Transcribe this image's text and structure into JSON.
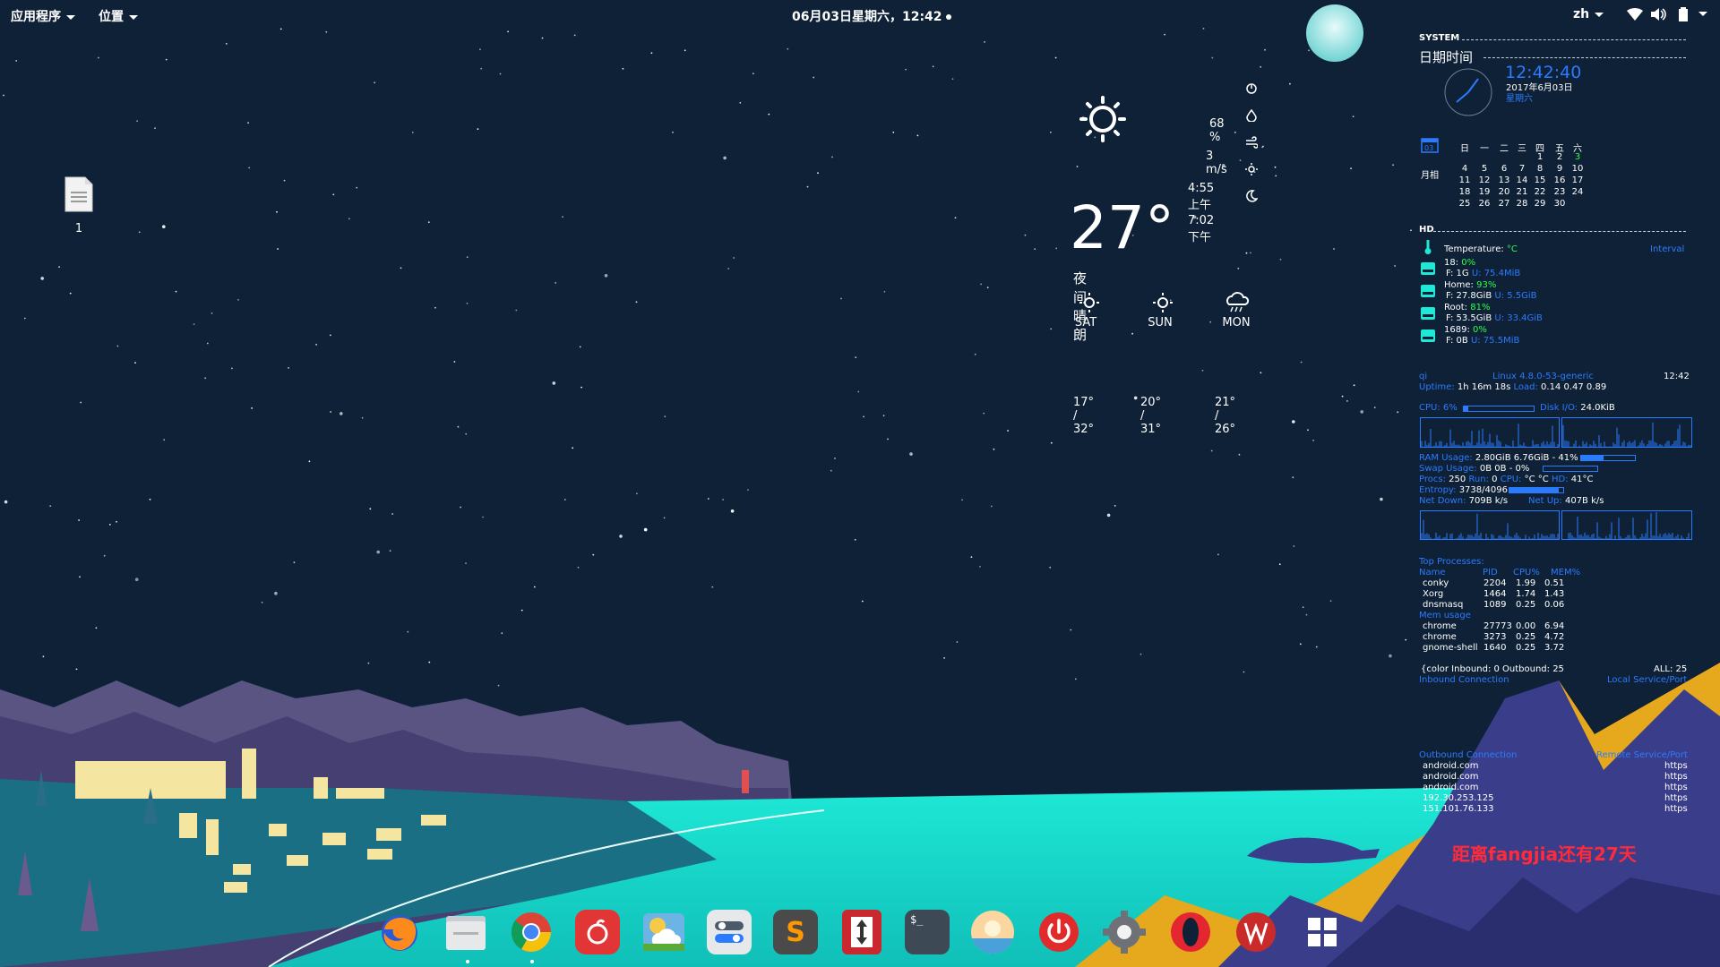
{
  "topbar": {
    "applications_label": "应用程序",
    "places_label": "位置",
    "datetime": "06月03日星期六，12:42",
    "language": "zh",
    "icons": [
      "wifi-icon",
      "volume-icon",
      "battery-icon",
      "power-menu-icon"
    ]
  },
  "desktop": {
    "files": [
      {
        "label": "1",
        "icon": "document-icon"
      }
    ]
  },
  "weather": {
    "current_icon": "sun-icon",
    "temperature": "27°",
    "condition": "夜间晴朗",
    "humidity": "68 %",
    "wind": "3 m/s",
    "sunrise": "4:55 上午",
    "sunset": "7:02 下午",
    "side_icons": [
      "pressure-icon",
      "humidity-icon",
      "wind-icon",
      "sunrise-icon",
      "moon-icon"
    ],
    "forecast": [
      {
        "day": "SAT",
        "icon": "sun-icon",
        "range": "17° / 32°"
      },
      {
        "day": "SUN",
        "icon": "sun-icon",
        "range": "20° / 31°"
      },
      {
        "day": "MON",
        "icon": "rain-cloud-icon",
        "range": "21° / 26°"
      }
    ]
  },
  "conky": {
    "system_header": "SYSTEM",
    "datetime_header": "日期时间",
    "clock_digital": "12:42:40",
    "date_line": "2017年6月03日",
    "weekday_line": "星期六",
    "calendar": {
      "icon_day": "03",
      "month_label": "月相",
      "weekdays": [
        "日",
        "一",
        "二",
        "三",
        "四",
        "五",
        "六"
      ],
      "rows": [
        [
          "",
          "",
          "",
          "",
          "1",
          "2",
          "3"
        ],
        [
          "4",
          "5",
          "6",
          "7",
          "8",
          "9",
          "10"
        ],
        [
          "11",
          "12",
          "13",
          "14",
          "15",
          "16",
          "17"
        ],
        [
          "18",
          "19",
          "20",
          "21",
          "22",
          "23",
          "24"
        ],
        [
          "25",
          "26",
          "27",
          "28",
          "29",
          "30",
          ""
        ]
      ],
      "today": "3"
    },
    "hd_header": "HD",
    "temperature_label": "Temperature:",
    "temperature_unit": "°C",
    "temperature_right": "Interval",
    "disks": [
      {
        "name": "18:",
        "pct": "0%",
        "free": "F: 1G",
        "used": "U: 75.4MiB"
      },
      {
        "name": "Home:",
        "pct": "93%",
        "free": "F: 27.8GiB",
        "used": "U: 5.5GiB"
      },
      {
        "name": "Root:",
        "pct": "81%",
        "free": "F: 53.5GiB",
        "used": "U: 33.4GiB"
      },
      {
        "name": "1689:",
        "pct": "0%",
        "free": "F: 0B",
        "used": "U: 75.5MiB"
      }
    ],
    "hostname": "qi",
    "kernel": "Linux 4.8.0-53-generic",
    "time_short": "12:42",
    "uptime_label": "Uptime:",
    "uptime": "1h 16m 18s",
    "load_label": "Load:",
    "load": "0.14 0.47 0.89",
    "cpu_label": "CPU: 6%",
    "cpu_pct": 6,
    "diskio_label": "Disk I/O:",
    "diskio": "24.0KiB",
    "ram_label": "RAM Usage:",
    "ram": "2.80GiB 6.76GiB - 41%",
    "ram_pct": 41,
    "swap_label": "Swap Usage:",
    "swap": "0B   0B   - 0%",
    "swap_pct": 0,
    "procs_label": "Procs:",
    "procs": "250",
    "run_label": "Run:",
    "run": "0",
    "cpu_temp_label": "CPU:",
    "cpu_temp": "°C °C",
    "hd_temp_label": "HD:",
    "hd_temp": "41°C",
    "entropy_label": "Entropy:",
    "entropy": "3738/4096",
    "entropy_pct": 91,
    "netdown_label": "Net Down:",
    "netdown": "709B   k/s",
    "netup_label": "Net Up:",
    "netup": "407B   k/s",
    "top_header": "Top Processes:",
    "proc_cols": [
      "Name",
      "PID",
      "CPU%",
      "MEM%"
    ],
    "top_procs": [
      {
        "name": "conky",
        "pid": "2204",
        "cpu": "1.99",
        "mem": "0.51"
      },
      {
        "name": "Xorg",
        "pid": "1464",
        "cpu": "1.74",
        "mem": "1.43"
      },
      {
        "name": "dnsmasq",
        "pid": "1089",
        "cpu": "0.25",
        "mem": "0.06"
      }
    ],
    "mem_header": "Mem usage",
    "mem_procs": [
      {
        "name": "chrome",
        "pid": "27773",
        "cpu": "0.00",
        "mem": "6.94"
      },
      {
        "name": "chrome",
        "pid": "3273",
        "cpu": "0.25",
        "mem": "4.72"
      },
      {
        "name": "gnome-shell",
        "pid": "1640",
        "cpu": "0.25",
        "mem": "3.72"
      }
    ],
    "conn_line": "{color  Inbound: 0  Outbound: 25",
    "conn_all": "ALL: 25",
    "inbound_header": "Inbound Connection",
    "inbound_right": "Local Service/Port",
    "outbound_header": "Outbound Connection",
    "outbound_right": "Remote Service/Port",
    "outbound": [
      {
        "host": "android.com",
        "svc": "https"
      },
      {
        "host": "android.com",
        "svc": "https"
      },
      {
        "host": "android.com",
        "svc": "https"
      },
      {
        "host": "192.30.253.125",
        "svc": "https"
      },
      {
        "host": "151.101.76.133",
        "svc": "https"
      }
    ]
  },
  "countdown": "距离fangjia还有27天",
  "dock": {
    "apps": [
      {
        "name": "firefox",
        "icon": "firefox-icon",
        "running": true
      },
      {
        "name": "files",
        "icon": "folder-icon",
        "running": true
      },
      {
        "name": "chrome",
        "icon": "chrome-icon",
        "running": true
      },
      {
        "name": "netease-music",
        "icon": "music-icon",
        "running": false
      },
      {
        "name": "weather",
        "icon": "weather-icon",
        "running": false
      },
      {
        "name": "tweaks",
        "icon": "toggle-icon",
        "running": false
      },
      {
        "name": "sublime",
        "icon": "sublime-icon",
        "running": false
      },
      {
        "name": "transfer",
        "icon": "updown-arrow-icon",
        "running": false
      },
      {
        "name": "terminal",
        "icon": "terminal-icon",
        "running": false
      },
      {
        "name": "photos",
        "icon": "photo-icon",
        "running": false
      },
      {
        "name": "shutdown",
        "icon": "power-icon",
        "running": false
      },
      {
        "name": "settings",
        "icon": "gear-icon",
        "running": false
      },
      {
        "name": "opera",
        "icon": "opera-icon",
        "running": false
      },
      {
        "name": "wps",
        "icon": "wps-icon",
        "running": false
      },
      {
        "name": "show-apps",
        "icon": "grid-icon",
        "running": false
      }
    ]
  },
  "colors": {
    "sky": "#0f2136",
    "sea": "#1ee8d6",
    "accent_blue": "#2b7bff",
    "accent_green": "#2cff4a",
    "countdown_red": "#ff2a3a",
    "sand_gold": "#e6a81c"
  }
}
